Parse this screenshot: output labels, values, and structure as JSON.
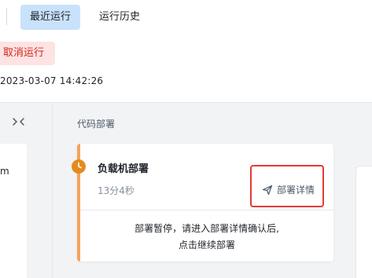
{
  "tabs": {
    "recent": "最近运行",
    "history": "运行历史"
  },
  "run": {
    "cancel_label": "取消运行",
    "start_time": "2023-03-07 14:42:26"
  },
  "sidebar": {
    "fragment_text": "m"
  },
  "stage": {
    "title": "代码部署",
    "job": {
      "name": "负载机部署",
      "duration": "13分4秒",
      "detail_label": "部署详情",
      "status": "paused",
      "status_color": "#e58a1f",
      "message_line1": "部署暂停，请进入部署详情确认后,",
      "message_line2": "点击继续部署"
    }
  },
  "icons": {
    "collapse": "collapse-arrows-icon",
    "status": "clock-icon",
    "detail": "send-icon"
  },
  "colors": {
    "active_tab_bg": "#c9e2fb",
    "cancel_bg": "#fde3e3",
    "cancel_text": "#d4271b",
    "accent": "#f5a25d",
    "highlight_border": "#e53935"
  }
}
